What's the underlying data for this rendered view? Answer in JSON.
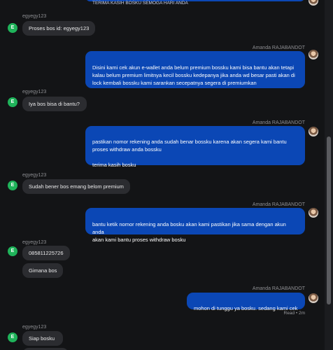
{
  "agent_name": "Amanda RAJABANDOT",
  "user_name": "egyegy123",
  "user_initial": "E",
  "top_partial_text": "TERIMA KASIH BOSKU SEMOGA HARI ANDA",
  "messages": [
    {
      "text": "Proses bos id: egyegy123"
    },
    {
      "text": "Disini kami cek akun e-wallet anda belum premium bossku kami bisa bantu akan tetapi\nkalau belum premium limitnya kecil bossku kedepanya jika anda wd besar pasti akan di\nlock kembali bossku kami sarankan secepatnya segera di premiumkan"
    },
    {
      "text": "Iya bos bisa di bantu?"
    },
    {
      "text": "pastikan nomor rekening anda sudah benar bossku karena akan segera kami bantu\nproses withdraw anda bossku\n\nterima kasih bosku"
    },
    {
      "text": "Sudah bener bos emang belom premium"
    },
    {
      "text": "bantu ketik nomor rekening anda bosku akan kami pastikan jika sama dengan akun anda\nakan kami bantu proses withdraw bosku"
    },
    {
      "text": "085811225726"
    },
    {
      "text": "Gimana bos"
    },
    {
      "text": "mohon di tunggu ya bosku. sedang kami cek"
    },
    {
      "text": "Siap bosku"
    }
  ],
  "read_status": "Read",
  "read_time": "2m"
}
